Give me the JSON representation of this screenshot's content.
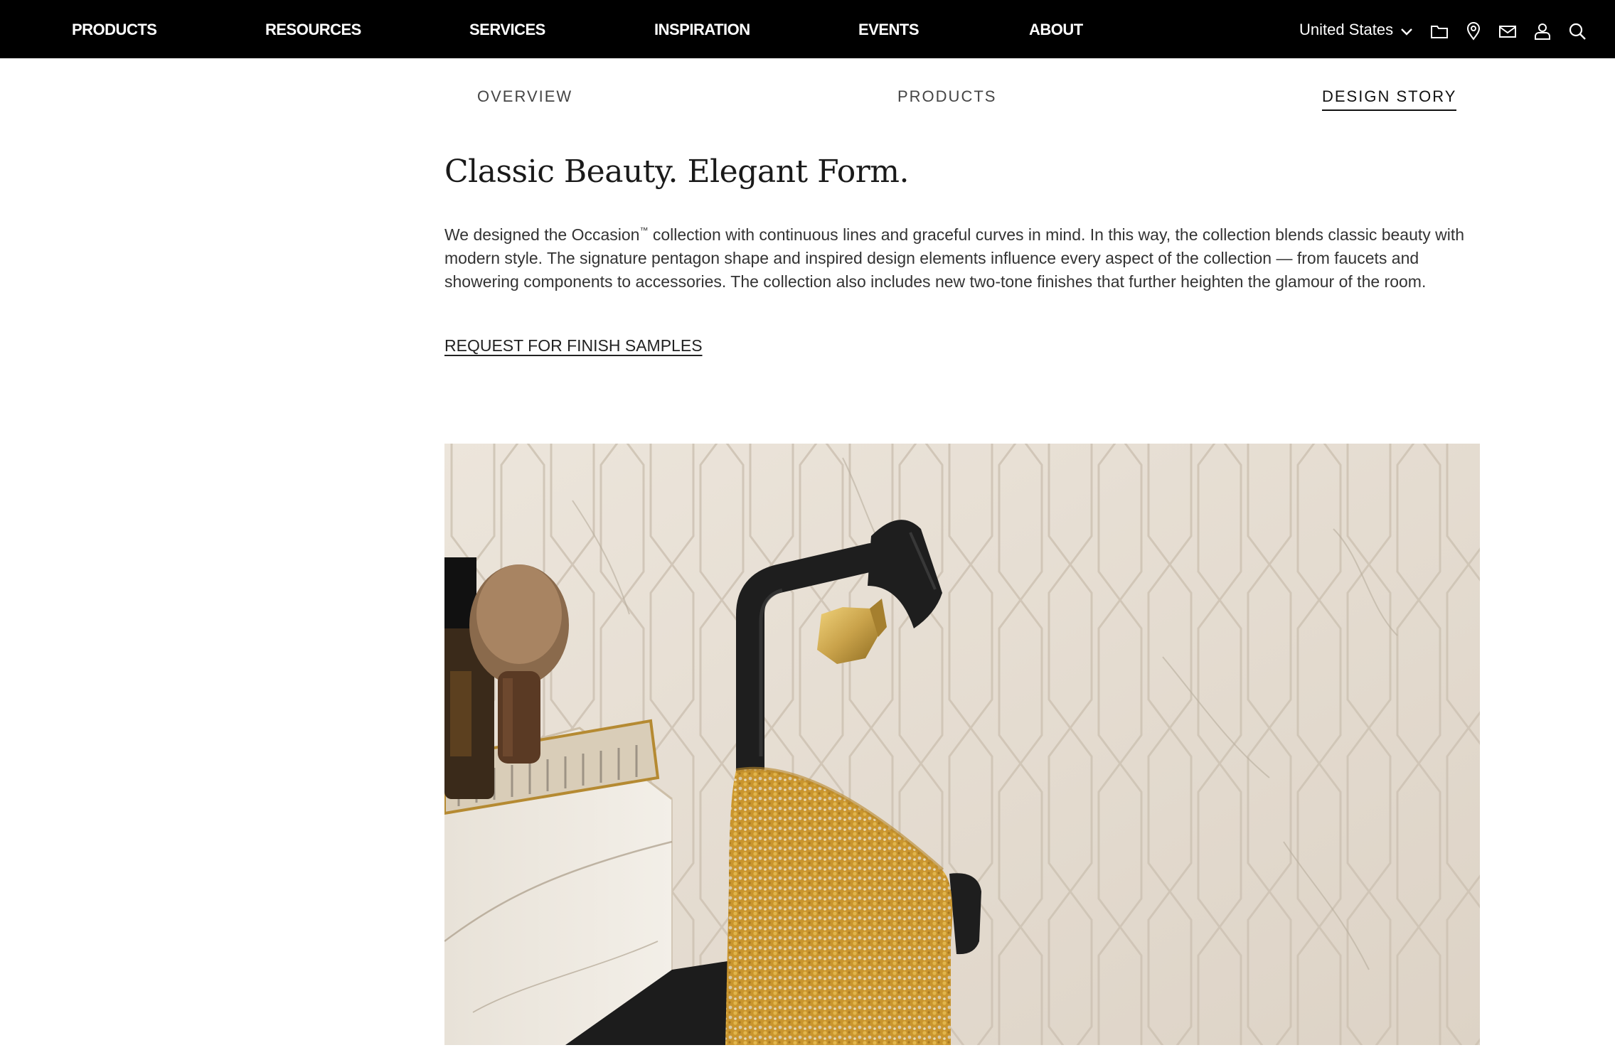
{
  "top_nav": {
    "items": [
      "PRODUCTS",
      "RESOURCES",
      "SERVICES",
      "INSPIRATION",
      "EVENTS",
      "ABOUT"
    ],
    "region_label": "United States",
    "icons": [
      "chevron-down-icon",
      "folder-icon",
      "location-pin-icon",
      "mail-icon",
      "user-icon",
      "search-icon"
    ]
  },
  "sub_nav": {
    "items": [
      "OVERVIEW",
      "PRODUCTS",
      "DESIGN STORY"
    ],
    "active": "DESIGN STORY"
  },
  "content": {
    "headline": "Classic Beauty. Elegant Form.",
    "body_before_tm": "We designed the Occasion",
    "tm": "™",
    "body_after_tm": " collection with continuous lines and graceful curves in mind. In this way, the collection blends classic beauty with modern style. The signature pentagon shape and inspired design elements influence every aspect of the collection — from faucets and showering components to accessories. The collection also includes new two-tone finishes that further heighten the glamour of the room.",
    "cta_label": "REQUEST FOR FINISH SAMPLES"
  },
  "colors": {
    "nav_background": "#000000",
    "nav_text": "#ffffff",
    "accent_brass": "#c9a24a",
    "fixture_black": "#1e1e1e"
  }
}
